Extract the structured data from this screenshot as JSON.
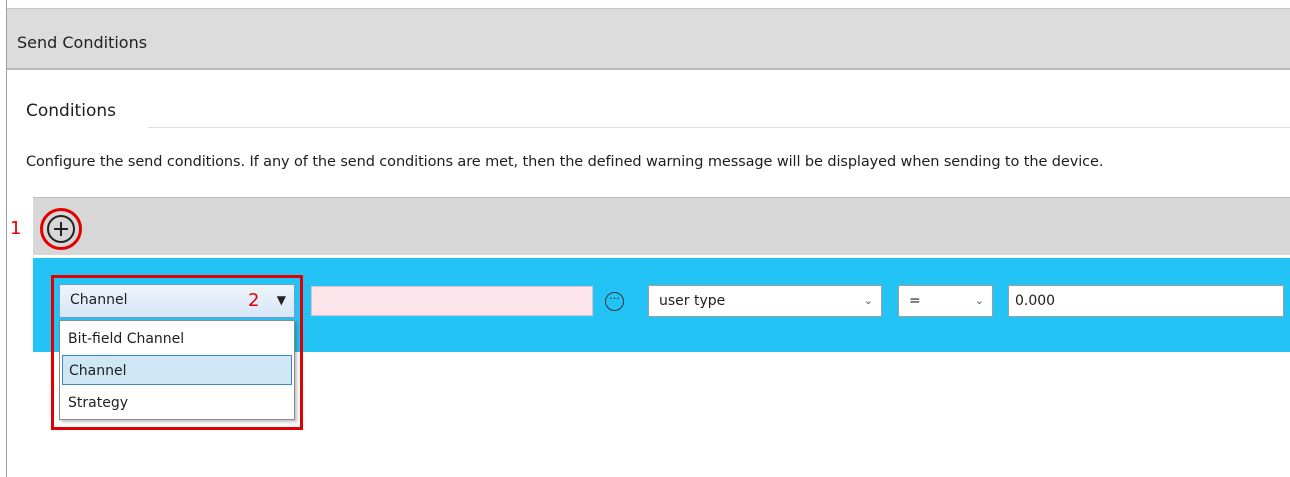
{
  "panel": {
    "title": "Send Conditions"
  },
  "section": {
    "title": "Conditions",
    "description": "Configure the send conditions. If any of the send conditions are met, then the defined warning message will be displayed when sending to the device."
  },
  "toolbar": {
    "add_icon": "plus-circle-icon"
  },
  "annotations": {
    "marker_1": "1",
    "marker_2": "2",
    "color": "#e00000"
  },
  "condition_row": {
    "background": "#23c3f5",
    "type_select": {
      "value": "Channel",
      "options": [
        "Bit-field Channel",
        "Channel",
        "Strategy"
      ],
      "highlighted_option": "Channel"
    },
    "name_field": {
      "value": ""
    },
    "browse_icon": "ellipsis-circle-icon",
    "usertype_select": {
      "value": "user type"
    },
    "operator_select": {
      "value": "="
    },
    "value_input": {
      "value": "0.000"
    }
  }
}
